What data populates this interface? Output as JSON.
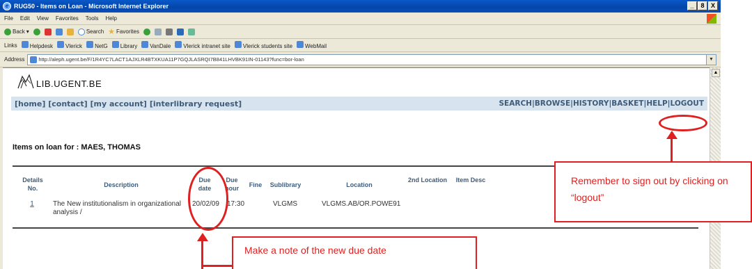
{
  "window": {
    "title": "RUG50 - Items on Loan - Microsoft Internet Explorer",
    "controls": [
      "_",
      "8",
      "X"
    ]
  },
  "menubar": [
    "File",
    "Edit",
    "View",
    "Favorites",
    "Tools",
    "Help"
  ],
  "toolbar": {
    "back": "Back",
    "search": "Search",
    "favorites": "Favorites"
  },
  "links_bar": {
    "label": "Links",
    "items": [
      "Helpdesk",
      "Vlerick",
      "NetG",
      "Library",
      "VanDale",
      "Vlerick intranet site",
      "Vlerick students site",
      "WebMail"
    ]
  },
  "address_bar": {
    "label": "Address",
    "url": "http://aleph.ugent.be/F/1R4YC7LACT1AJXLR4BTXKUA11P7GQJLASRQI7B841LHVBK91IN-01143?func=bor-loan"
  },
  "site": {
    "logo_text": "LIB.UGENT.BE",
    "nav_left": [
      "[home]",
      "[contact]",
      "[my account]",
      "[interlibrary request]"
    ],
    "nav_right": [
      "SEARCH",
      "BROWSE",
      "HISTORY",
      "BASKET",
      "HELP",
      "LOGOUT"
    ],
    "nav_separator": " | "
  },
  "loans": {
    "heading": "Items on loan for : MAES, THOMAS",
    "columns": [
      "Details No.",
      "Description",
      "Due date",
      "Due hour",
      "Fine",
      "Sublibrary",
      "Location",
      "2nd Location",
      "Item Desc"
    ],
    "rows": [
      {
        "no": "1",
        "description": "The New institutionalism in organizational analysis /",
        "due_date": "20/02/09",
        "due_hour": "17:30",
        "fine": "",
        "sublibrary": "VLGMS",
        "location": "VLGMS.AB/OR.POWE91",
        "second_location": "",
        "item_desc": ""
      }
    ]
  },
  "annotations": {
    "logout_note": "Remember to sign out by clicking on “logout”",
    "due_date_note": "Make a note of the new due date"
  },
  "colors": {
    "accent_red": "#e02020",
    "nav_bg": "#d7e3ee",
    "nav_text": "#3e5c7a",
    "titlebar_blue": "#0a58c8"
  }
}
